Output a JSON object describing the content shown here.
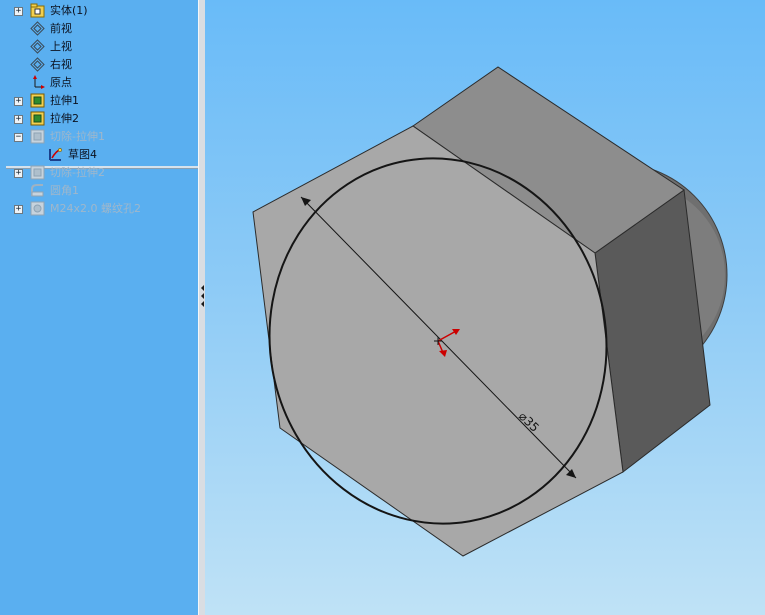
{
  "feature_tree": {
    "items": [
      {
        "label": "实体(1)",
        "icon": "solid-body-folder-icon",
        "expander": "+",
        "state": "normal"
      },
      {
        "label": "前视",
        "icon": "plane-icon",
        "expander": "",
        "state": "normal"
      },
      {
        "label": "上视",
        "icon": "plane-icon",
        "expander": "",
        "state": "normal"
      },
      {
        "label": "右视",
        "icon": "plane-icon",
        "expander": "",
        "state": "normal"
      },
      {
        "label": "原点",
        "icon": "origin-icon",
        "expander": "",
        "state": "normal"
      },
      {
        "label": "拉伸1",
        "icon": "extrude-icon",
        "expander": "+",
        "state": "normal"
      },
      {
        "label": "拉伸2",
        "icon": "extrude-icon",
        "expander": "+",
        "state": "normal"
      },
      {
        "label": "切除-拉伸1",
        "icon": "cut-extrude-icon",
        "expander": "−",
        "state": "dim"
      },
      {
        "label": "草图4",
        "icon": "sketch-icon",
        "expander": "",
        "state": "normal"
      },
      {
        "label": "切除-拉伸2",
        "icon": "cut-extrude-icon",
        "expander": "+",
        "state": "dim"
      },
      {
        "label": "圆角1",
        "icon": "fillet-icon",
        "expander": "",
        "state": "dim"
      },
      {
        "label": "M24x2.0 螺纹孔2",
        "icon": "thread-hole-icon",
        "expander": "+",
        "state": "dim"
      }
    ]
  },
  "viewport": {
    "dimension_label": "⌀35"
  },
  "colors": {
    "accent_sketch": "#cc0000",
    "extrude_icon": "#2d8b2d"
  }
}
